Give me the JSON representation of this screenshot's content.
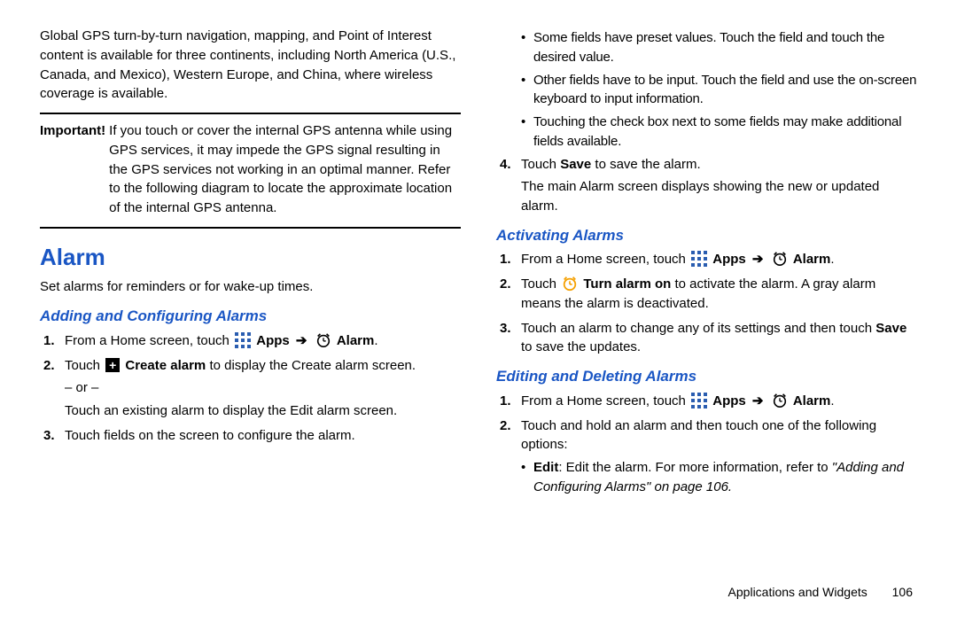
{
  "col1": {
    "intro": "Global GPS turn-by-turn navigation, mapping, and Point of Interest content is available for three continents, including North America (U.S., Canada, and Mexico), Western Europe, and China, where wireless coverage is available.",
    "important_label": "Important!",
    "important_text": "If you touch or cover the internal GPS antenna while using GPS services, it may impede the GPS signal resulting in the GPS services not working in an optimal manner. Refer to the following diagram to locate the approximate location of the internal GPS antenna.",
    "alarm_heading": "Alarm",
    "alarm_sub": "Set alarms for reminders or for wake-up times.",
    "adding_heading": "Adding and Configuring Alarms",
    "step1_a": "From a Home screen, touch ",
    "apps_label": "Apps",
    "alarm_label": "Alarm",
    "step2_a": "Touch ",
    "step2_create": "Create alarm",
    "step2_b": " to display the Create alarm screen.",
    "or": "– or –",
    "step2_c": "Touch an existing alarm to display the Edit alarm screen.",
    "step3": "Touch fields on the screen to configure the alarm."
  },
  "col2": {
    "bul1": "Some fields have preset values. Touch the field and touch the desired value.",
    "bul2": "Other fields have to be input. Touch the field and use the on-screen keyboard to input information.",
    "bul3": "Touching the check box next to some fields may make additional fields available.",
    "step4_a": "Touch ",
    "step4_save": "Save",
    "step4_b": " to save the alarm.",
    "step4_c": "The main Alarm screen displays showing the new or updated alarm.",
    "activating_heading": "Activating Alarms",
    "act_step1_a": "From a Home screen, touch ",
    "apps_label": "Apps",
    "alarm_label": "Alarm",
    "act_step2_a": "Touch ",
    "act_step2_turn": "Turn alarm on",
    "act_step2_b": " to activate the alarm. A gray alarm means the alarm is deactivated.",
    "act_step3_a": "Touch an alarm to change any of its settings and then touch ",
    "act_step3_save": "Save",
    "act_step3_b": " to save the updates.",
    "editing_heading": "Editing and Deleting Alarms",
    "edit_step1_a": "From a Home screen, touch ",
    "edit_step2": "Touch and hold an alarm and then touch one of the following options:",
    "edit_bul1_label": "Edit",
    "edit_bul1_a": ": Edit the alarm. For more information, refer to ",
    "edit_bul1_ref": "\"Adding and Configuring Alarms\"",
    "edit_bul1_b": " on page 106."
  },
  "footer": {
    "chapter": "Applications and Widgets",
    "page": "106"
  }
}
